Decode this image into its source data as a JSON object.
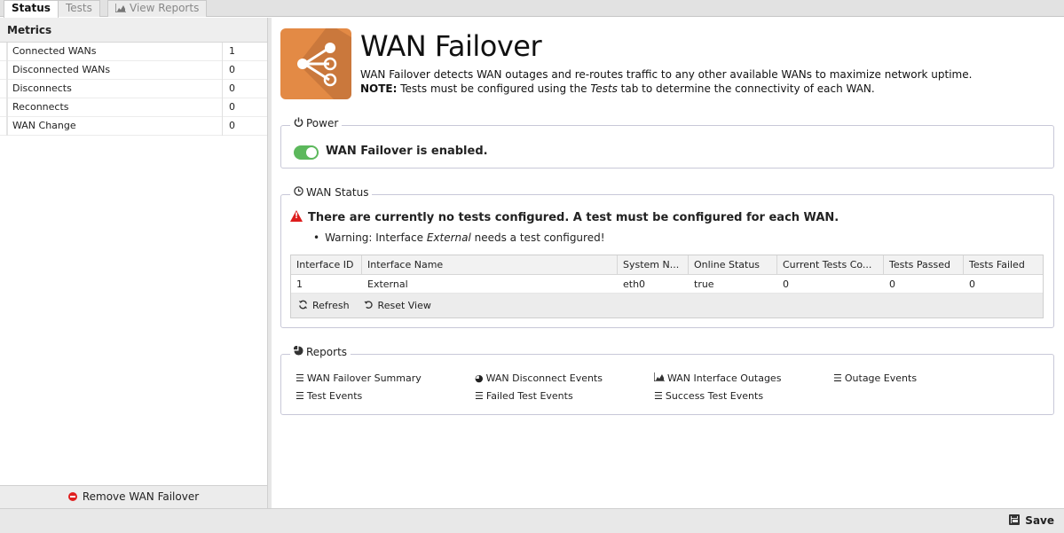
{
  "tabs": [
    {
      "label": "Status",
      "active": true
    },
    {
      "label": "Tests",
      "active": false
    },
    {
      "label": "View Reports",
      "active": false,
      "icon": "area-chart-icon"
    }
  ],
  "metrics": {
    "title": "Metrics",
    "rows": [
      {
        "name": "Connected WANs",
        "value": "1"
      },
      {
        "name": "Disconnected WANs",
        "value": "0"
      },
      {
        "name": "Disconnects",
        "value": "0"
      },
      {
        "name": "Reconnects",
        "value": "0"
      },
      {
        "name": "WAN Change",
        "value": "0"
      }
    ],
    "remove_label": "Remove WAN Failover"
  },
  "header": {
    "title": "WAN Failover",
    "description": "WAN Failover detects WAN outages and re-routes traffic to any other available WANs to maximize network uptime.",
    "note_label": "NOTE:",
    "note_pre": " Tests must be configured using the ",
    "note_em": "Tests",
    "note_post": " tab to determine the connectivity of each WAN."
  },
  "power": {
    "legend": "Power",
    "status_text": "WAN Failover is enabled.",
    "enabled": true
  },
  "wan_status": {
    "legend": "WAN Status",
    "warning": "There are currently no tests configured. A test must be configured for each WAN.",
    "item_pre": "Warning: Interface ",
    "item_em": "External",
    "item_post": " needs a test configured!",
    "columns": [
      "Interface ID",
      "Interface Name",
      "System N...",
      "Online Status",
      "Current Tests Co...",
      "Tests Passed",
      "Tests Failed"
    ],
    "rows": [
      [
        "1",
        "External",
        "eth0",
        "true",
        "0",
        "0",
        "0"
      ]
    ],
    "refresh_label": "Refresh",
    "reset_label": "Reset View"
  },
  "reports": {
    "legend": "Reports",
    "items": [
      {
        "label": "WAN Failover Summary",
        "icon": "list-icon"
      },
      {
        "label": "WAN Disconnect Events",
        "icon": "pie-chart-icon"
      },
      {
        "label": "WAN Interface Outages",
        "icon": "area-chart-icon"
      },
      {
        "label": "Outage Events",
        "icon": "list-icon"
      },
      {
        "label": "Test Events",
        "icon": "list-icon"
      },
      {
        "label": "Failed Test Events",
        "icon": "list-icon"
      },
      {
        "label": "Success Test Events",
        "icon": "list-icon"
      }
    ]
  },
  "footer": {
    "save_label": "Save"
  },
  "colors": {
    "app_icon": "#e38a45",
    "toggle_on": "#5cb85c",
    "warning": "#dd1d1d"
  }
}
